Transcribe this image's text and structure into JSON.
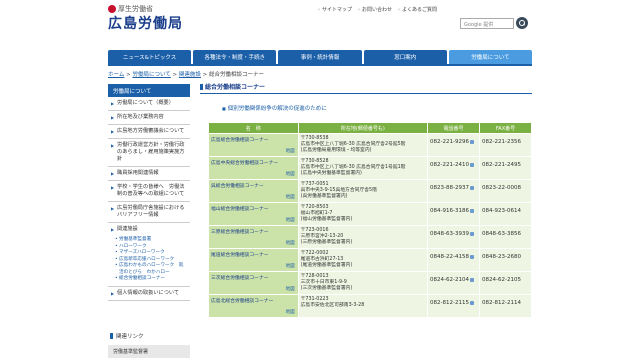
{
  "header": {
    "ministry": "厚生労働省",
    "title": "広島労働局",
    "links": [
      "サイトマップ",
      "お問い合わせ",
      "よくあるご質問"
    ],
    "search_placeholder": "Google 提供"
  },
  "nav": {
    "tabs": [
      "ニュース&トピックス",
      "各種法令・制度・手続き",
      "事例・統計情報",
      "窓口案内",
      "労働局について"
    ]
  },
  "breadcrumb": {
    "home": "ホーム",
    "sep": ">",
    "items": [
      "労働局について",
      "関連施設"
    ],
    "current": "総合労働相談コーナー"
  },
  "sidebar": {
    "header": "労働局について",
    "items": [
      "労働局について（概要）",
      "所在地及び業務内容",
      "広島地方労働審議会について",
      "労働行政運営方針・労働行政のあらまし・雇用施策実施方針",
      "職員採用関連情報",
      "学校・学生の皆様へ　労働法制の普及等への取組について",
      "広島労働局庁舎施設におけるバリアフリー情報",
      "関連施設"
    ],
    "subitems": [
      "労働基準監督署",
      "ハローワーク",
      "マザーズハローワーク",
      "広島新卒応援ハローワーク",
      "広島わかものハローワーク　就活のとびら　わかハロー",
      "総合労働相談コーナー"
    ],
    "last_item": "個人情報の取扱いについて",
    "related_heading": "関連リンク",
    "related_item": "労働基準監督署"
  },
  "main": {
    "title": "総合労働相談コーナー",
    "link": "個別労働関係紛争の解決の促進のために",
    "table": {
      "headers": [
        "名　称",
        "所在地(郵便番号も)",
        "電話番号",
        "FAX番号"
      ],
      "rows": [
        {
          "name": "広島総合労働相談コーナー",
          "map": "地図",
          "zip": "〒730-8538",
          "addr1": "広島市中区上八丁堀6-30 広島合同庁舎2号館5階",
          "addr2": "(広島労働局雇用環境・均等室内)",
          "tel": "082-221-9296",
          "fax": "082-221-2356"
        },
        {
          "name": "広島中央総合労働相談コーナー",
          "map": "地図",
          "zip": "〒730-8528",
          "addr1": "広島市中区上八丁堀6-30 広島合同庁舎1号館1階",
          "addr2": "(広島中央労働基準監督署内)",
          "tel": "082-221-2410",
          "fax": "082-221-2495"
        },
        {
          "name": "呉総合労働相談コーナー",
          "map": "地図",
          "zip": "〒737-0051",
          "addr1": "呉市中央3-9-15呉地方合同庁舎5階",
          "addr2": "(呉労働基準監督署内)",
          "tel": "0823-88-2937",
          "fax": "0823-22-0008"
        },
        {
          "name": "福山総合労働相談コーナー",
          "map": "地図",
          "zip": "〒720-8503",
          "addr1": "福山市旭町1-7",
          "addr2": "(福山労働基準監督署内)",
          "tel": "084-916-3186",
          "fax": "084-923-0614"
        },
        {
          "name": "三原総合労働相談コーナー",
          "map": "地図",
          "zip": "〒723-0016",
          "addr1": "三原市宮沖2-13-20",
          "addr2": "(三原労働基準監督署内)",
          "tel": "0848-63-3939",
          "fax": "0848-63-3856"
        },
        {
          "name": "尾道総合労働相談コーナー",
          "map": "地図",
          "zip": "〒722-0002",
          "addr1": "尾道市古浜町27-13",
          "addr2": "(尾道労働基準監督署内)",
          "tel": "0848-22-4158",
          "fax": "0848-23-2680"
        },
        {
          "name": "三次総合労働相談コーナー",
          "map": "地図",
          "zip": "〒728-0013",
          "addr1": "三次市十日市東1-9-9",
          "addr2": "(三次労働基準監督署内)",
          "tel": "0824-62-2104",
          "fax": "0824-62-2105"
        },
        {
          "name": "広島北総合労働相談コーナー",
          "map": "地図",
          "zip": "〒731-0223",
          "addr1": "広島市安佐北区可部南3-3-28",
          "addr2": "",
          "tel": "082-812-2115",
          "fax": "082-812-2114"
        }
      ]
    }
  },
  "colors": {
    "brand_blue": "#1b5fa8",
    "table_header_green": "#7bb042",
    "name_cell_green": "#cbe2a8"
  }
}
